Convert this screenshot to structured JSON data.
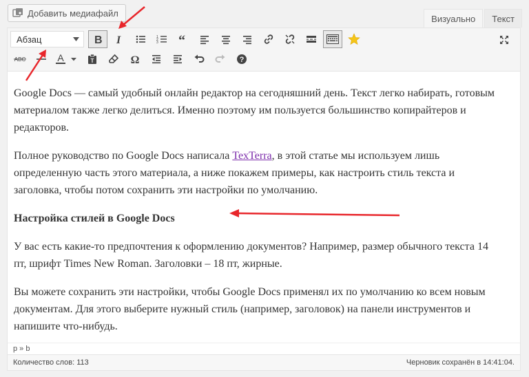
{
  "media_button": {
    "label": "Добавить медиафайл",
    "icon": "media-icon"
  },
  "tabs": [
    {
      "label": "Визуально",
      "active": true
    },
    {
      "label": "Текст",
      "active": false
    }
  ],
  "toolbar": {
    "format_select": {
      "value": "Абзац"
    },
    "row1_icons": [
      "bold-icon",
      "italic-icon",
      "bullet-list-icon",
      "numbered-list-icon",
      "blockquote-icon",
      "align-left-icon",
      "align-center-icon",
      "align-right-icon",
      "link-icon",
      "unlink-icon",
      "read-more-icon",
      "toolbar-toggle-icon",
      "star-icon"
    ],
    "row2_icons": [
      "strikethrough-icon",
      "horizontal-line-icon",
      "text-color-icon",
      "paste-text-icon",
      "clear-format-icon",
      "special-char-icon",
      "outdent-icon",
      "indent-icon",
      "undo-icon",
      "redo-icon",
      "help-icon"
    ],
    "strike_label": "ABC",
    "color_label": "A",
    "accent": "#d54e21"
  },
  "content": {
    "p1": "Google Docs — самый удобный онлайн редактор на сегодняшний день. Текст легко набирать, готовым материалом также легко делиться. Именно поэтому им пользуется большинство копирайтеров и редакторов.",
    "p2_before": "Полное руководство по Google Docs написала ",
    "p2_link": "TexTerra",
    "p2_after": ", в этой статье мы используем лишь определенную часть этого материала, а ниже покажем примеры, как настроить стиль текста и заголовка, чтобы потом сохранить эти настройки по умолчанию.",
    "heading": "Настройка стилей в Google Docs",
    "p3": "У вас есть какие-то предпочтения к оформлению документов? Например, размер обычного текста 14 пт, шрифт Times New Roman. Заголовки – 18 пт, жирные.",
    "p4": "Вы можете сохранить эти настройки, чтобы Google Docs применял их по умолчанию ко всем новым документам. Для этого выберите нужный стиль (например, заголовок) на панели инструментов и напишите что-нибудь."
  },
  "path": "p » b",
  "status": {
    "word_count": "Количество слов: 113",
    "saved": "Черновик сохранён в 14:41:04."
  },
  "annotation_color": "#e8262b"
}
